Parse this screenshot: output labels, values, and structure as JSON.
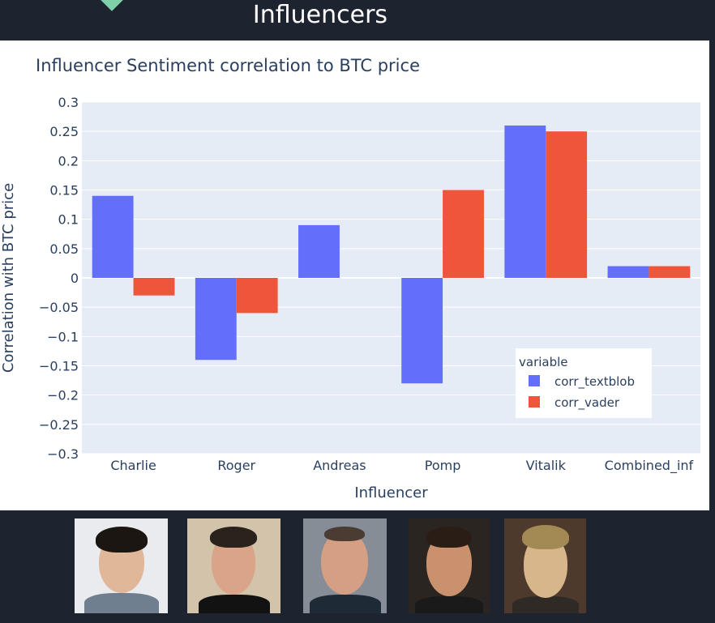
{
  "page": {
    "title": "Influencers"
  },
  "colors": {
    "background": "#1e2330",
    "plot_bg": "#e5ecf6",
    "corr_textblob": "#636efa",
    "corr_vader": "#ef553b",
    "text": "#2a3f5f",
    "accent": "#7fcfa9"
  },
  "chart_data": {
    "type": "bar",
    "title": "Influencer Sentiment correlation to BTC price",
    "xlabel": "Influencer",
    "ylabel": "Correlation with BTC price",
    "categories": [
      "Charlie",
      "Roger",
      "Andreas",
      "Pomp",
      "Vitalik",
      "Combined_inf"
    ],
    "series": [
      {
        "name": "corr_textblob",
        "color": "#636efa",
        "values": [
          0.14,
          -0.14,
          0.09,
          -0.18,
          0.26,
          0.02
        ]
      },
      {
        "name": "corr_vader",
        "color": "#ef553b",
        "values": [
          -0.03,
          -0.06,
          0.0,
          0.15,
          0.25,
          0.02
        ]
      }
    ],
    "ylim": [
      -0.3,
      0.3
    ],
    "y_ticks": [
      0.3,
      0.25,
      0.2,
      0.15,
      0.1,
      0.05,
      0,
      -0.05,
      -0.1,
      -0.15,
      -0.2,
      -0.25,
      -0.3
    ],
    "y_tick_labels": [
      "0.3",
      "0.25",
      "0.2",
      "0.15",
      "0.1",
      "0.05",
      "0",
      "−0.05",
      "−0.1",
      "−0.15",
      "−0.2",
      "−0.25",
      "−0.3"
    ],
    "legend": {
      "title": "variable",
      "position": "bottom-right inside plot"
    },
    "grid": true
  },
  "photos": [
    {
      "name": "charlie-photo",
      "bg": "#e9ebee",
      "hair": "#1b1612",
      "skin": "#e1b79a",
      "shirt": "#6f7f8f"
    },
    {
      "name": "roger-photo",
      "bg": "#d2c3aa",
      "hair": "#2a221c",
      "skin": "#d9a487",
      "shirt": "#121212"
    },
    {
      "name": "andreas-photo",
      "bg": "#868d96",
      "hair": "#4a3b33",
      "skin": "#d49f83",
      "shirt": "#1f2a37"
    },
    {
      "name": "pomp-photo",
      "bg": "#2b2522",
      "hair": "#2a1d15",
      "skin": "#c9916d",
      "shirt": "#1a1a1a"
    },
    {
      "name": "vitalik-photo",
      "bg": "#4e3a2c",
      "hair": "#a38a55",
      "skin": "#d8b68c",
      "shirt": "#2f2a26"
    }
  ]
}
